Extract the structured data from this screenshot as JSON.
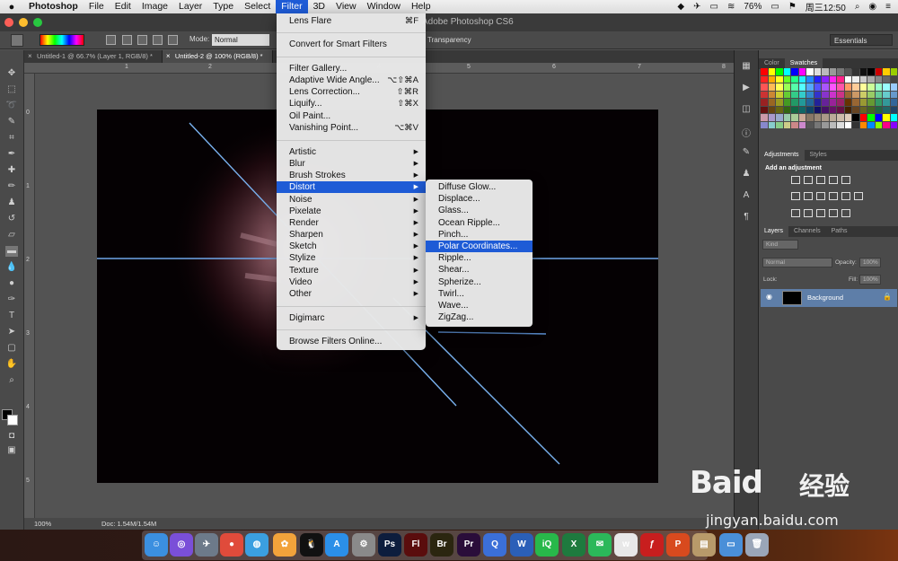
{
  "menubar": {
    "app_name": "Photoshop",
    "items": [
      "File",
      "Edit",
      "Image",
      "Layer",
      "Type",
      "Select",
      "Filter",
      "3D",
      "View",
      "Window",
      "Help"
    ],
    "active": "Filter",
    "battery": "76%",
    "clock": "周三12:50"
  },
  "window": {
    "title": "Adobe Photoshop CS6"
  },
  "options_bar": {
    "mode_label": "Mode:",
    "mode_value": "Normal",
    "transparency_label": "Transparency",
    "workspace": "Essentials"
  },
  "document_tabs": [
    {
      "label": "Untitled-1 @ 66.7% (Layer 1, RGB/8) *",
      "active": false
    },
    {
      "label": "Untitled-2 @ 100% (RGB/8) *",
      "active": true
    }
  ],
  "rulers": {
    "top": [
      "1",
      "2",
      "3",
      "4",
      "5",
      "6",
      "7",
      "8"
    ],
    "left": [
      "0",
      "1",
      "2",
      "3",
      "4",
      "5"
    ]
  },
  "status_bar": {
    "zoom": "100%",
    "doc": "Doc: 1.54M/1.54M"
  },
  "filter_menu": {
    "items": [
      {
        "label": "Lens Flare",
        "shortcut": "⌘F"
      },
      {
        "label": "Convert for Smart Filters"
      },
      {
        "label": "Filter Gallery..."
      },
      {
        "label": "Adaptive Wide Angle...",
        "shortcut": "⌥⇧⌘A"
      },
      {
        "label": "Lens Correction...",
        "shortcut": "⇧⌘R"
      },
      {
        "label": "Liquify...",
        "shortcut": "⇧⌘X"
      },
      {
        "label": "Oil Paint..."
      },
      {
        "label": "Vanishing Point...",
        "shortcut": "⌥⌘V"
      },
      {
        "label": "Artistic",
        "submenu": true
      },
      {
        "label": "Blur",
        "submenu": true
      },
      {
        "label": "Brush Strokes",
        "submenu": true
      },
      {
        "label": "Distort",
        "submenu": true,
        "highlighted": true
      },
      {
        "label": "Noise",
        "submenu": true
      },
      {
        "label": "Pixelate",
        "submenu": true
      },
      {
        "label": "Render",
        "submenu": true
      },
      {
        "label": "Sharpen",
        "submenu": true
      },
      {
        "label": "Sketch",
        "submenu": true
      },
      {
        "label": "Stylize",
        "submenu": true
      },
      {
        "label": "Texture",
        "submenu": true
      },
      {
        "label": "Video",
        "submenu": true
      },
      {
        "label": "Other",
        "submenu": true
      },
      {
        "label": "Digimarc",
        "submenu": true
      },
      {
        "label": "Browse Filters Online..."
      }
    ]
  },
  "distort_submenu": {
    "items": [
      "Diffuse Glow...",
      "Displace...",
      "Glass...",
      "Ocean Ripple...",
      "Pinch...",
      "Polar Coordinates...",
      "Ripple...",
      "Shear...",
      "Spherize...",
      "Twirl...",
      "Wave...",
      "ZigZag..."
    ],
    "highlighted": "Polar Coordinates..."
  },
  "panels": {
    "color_tabs": [
      "Color",
      "Swatches"
    ],
    "adjust_tabs": [
      "Adjustments",
      "Styles"
    ],
    "adjust_heading": "Add an adjustment",
    "layer_tabs": [
      "Layers",
      "Channels",
      "Paths"
    ],
    "kind_label": "Kind",
    "blend_mode": "Normal",
    "opacity_label": "Opacity:",
    "opacity_value": "100%",
    "lock_label": "Lock:",
    "fill_label": "Fill:",
    "fill_value": "100%",
    "layer_name": "Background"
  },
  "dock_apps": [
    "Finder",
    "Siri",
    "Launchpad",
    "Chrome",
    "Safari",
    "Photos",
    "QQ",
    "App Store",
    "System Preferences",
    "Ps",
    "Fl",
    "Br",
    "Pr",
    "QuickTime",
    "W",
    "iQIYI",
    "X",
    "WeChat",
    "W",
    "Flash",
    "P",
    "Archive",
    "Folder",
    "Trash"
  ],
  "watermark": {
    "brand": "Baid",
    "cn": "经验",
    "url": "jingyan.baidu.com"
  }
}
